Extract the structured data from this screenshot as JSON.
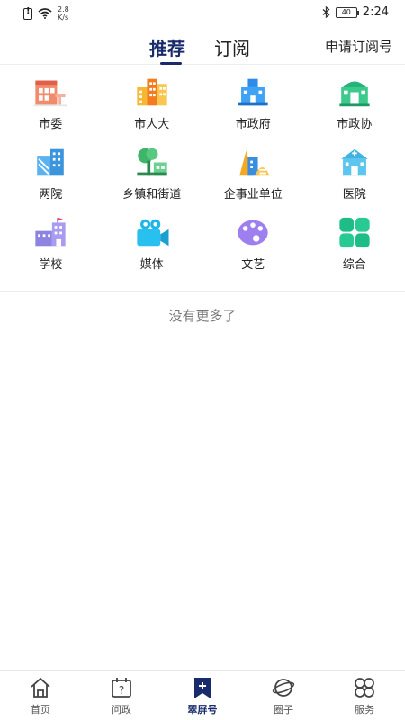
{
  "status_bar": {
    "speed": "2.8",
    "speed_unit": "K/s",
    "battery": "40",
    "time": "2:24"
  },
  "header": {
    "tabs": [
      "推荐",
      "订阅"
    ],
    "apply_link": "申请订阅号"
  },
  "categories": [
    {
      "label": "市委",
      "icon": "city-committee-icon"
    },
    {
      "label": "市人大",
      "icon": "buildings-icon"
    },
    {
      "label": "市政府",
      "icon": "government-building-icon"
    },
    {
      "label": "市政协",
      "icon": "conference-hall-icon"
    },
    {
      "label": "两院",
      "icon": "court-buildings-icon"
    },
    {
      "label": "乡镇和街道",
      "icon": "town-street-icon"
    },
    {
      "label": "企事业单位",
      "icon": "enterprise-icon"
    },
    {
      "label": "医院",
      "icon": "hospital-icon"
    },
    {
      "label": "学校",
      "icon": "school-icon"
    },
    {
      "label": "媒体",
      "icon": "video-camera-icon"
    },
    {
      "label": "文艺",
      "icon": "palette-icon"
    },
    {
      "label": "综合",
      "icon": "grid-squares-icon"
    }
  ],
  "empty_message": "没有更多了",
  "bottom_nav": [
    {
      "label": "首页",
      "icon": "home-icon"
    },
    {
      "label": "问政",
      "icon": "calendar-question-icon"
    },
    {
      "label": "翠屏号",
      "icon": "bookmark-plus-icon",
      "active": true
    },
    {
      "label": "圈子",
      "icon": "planet-icon"
    },
    {
      "label": "服务",
      "icon": "four-leaf-icon"
    }
  ],
  "colors": {
    "accent": "#1a2b6b"
  }
}
